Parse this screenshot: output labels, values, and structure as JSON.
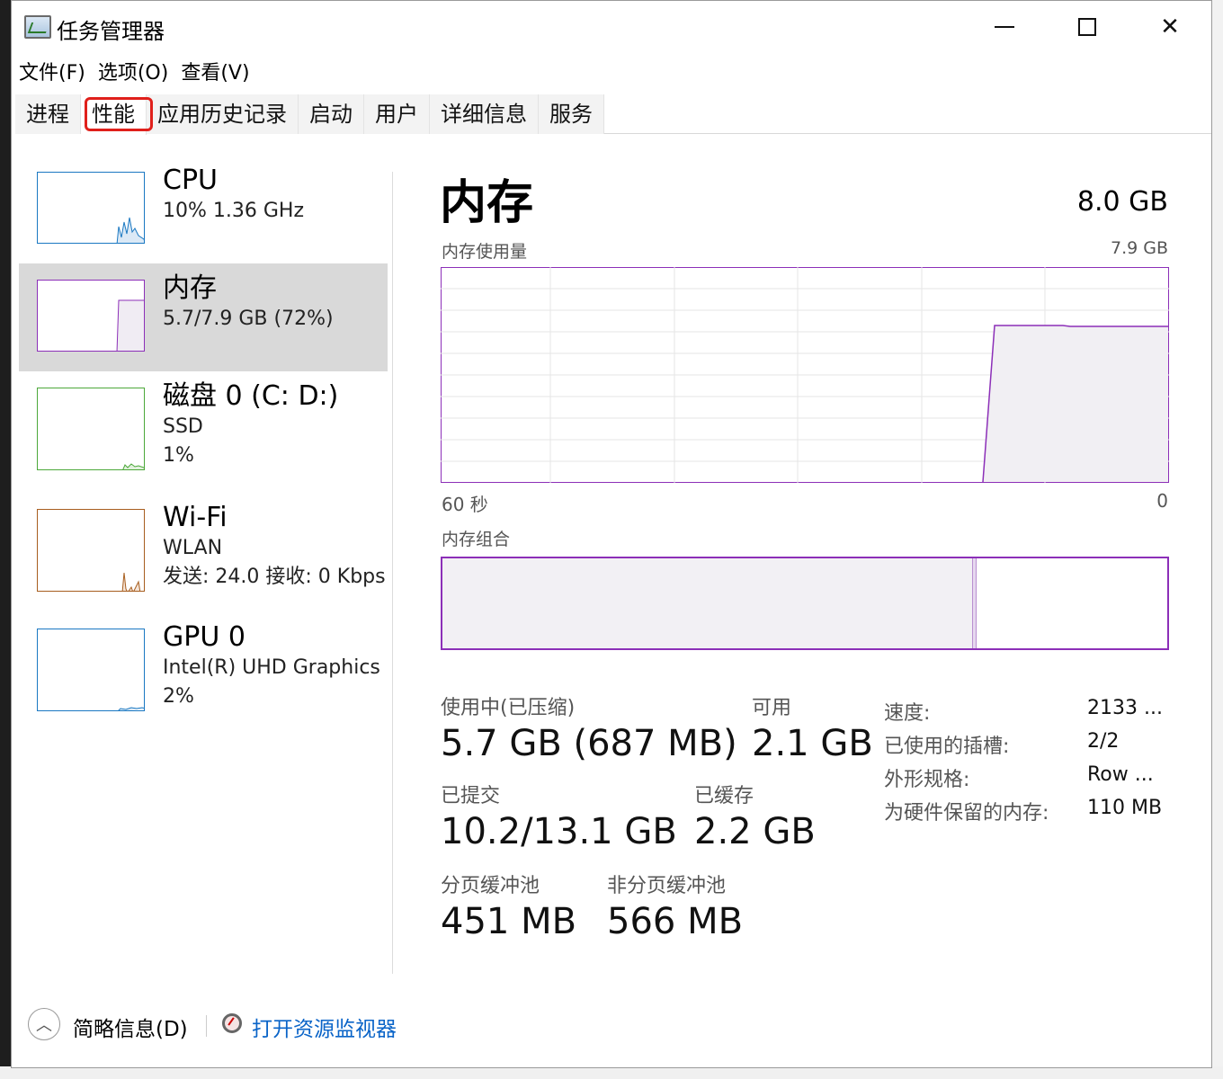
{
  "window": {
    "title": "任务管理器"
  },
  "menu": [
    "文件(F)",
    "选项(O)",
    "查看(V)"
  ],
  "tabs": [
    "进程",
    "性能",
    "应用历史记录",
    "启动",
    "用户",
    "详细信息",
    "服务"
  ],
  "active_tab": "性能",
  "sidebar": [
    {
      "title": "CPU",
      "lines": [
        "10%  1.36 GHz"
      ],
      "color": "#1a78c2"
    },
    {
      "title": "内存",
      "lines": [
        "5.7/7.9 GB (72%)"
      ],
      "color": "#8c2fb8"
    },
    {
      "title": "磁盘 0 (C: D:)",
      "lines": [
        "SSD",
        "1%"
      ],
      "color": "#4ca83a"
    },
    {
      "title": "Wi-Fi",
      "lines": [
        "WLAN",
        "发送: 24.0  接收: 0 Kbps"
      ],
      "color": "#a75d1e"
    },
    {
      "title": "GPU 0",
      "lines": [
        "Intel(R) UHD Graphics",
        "2%"
      ],
      "color": "#1a78c2"
    }
  ],
  "main": {
    "title": "内存",
    "total": "8.0 GB",
    "usage_label": "内存使用量",
    "usage_max": "7.9 GB",
    "axis_left": "60 秒",
    "axis_right": "0",
    "composition_label": "内存组合",
    "stats": {
      "in_use_label": "使用中(已压缩)",
      "in_use_value": "5.7 GB (687 MB)",
      "available_label": "可用",
      "available_value": "2.1 GB",
      "committed_label": "已提交",
      "committed_value": "10.2/13.1 GB",
      "cached_label": "已缓存",
      "cached_value": "2.2 GB",
      "paged_label": "分页缓冲池",
      "paged_value": "451 MB",
      "nonpaged_label": "非分页缓冲池",
      "nonpaged_value": "566 MB"
    },
    "details": [
      {
        "key": "速度:",
        "value": "2133 ..."
      },
      {
        "key": "已使用的插槽:",
        "value": "2/2"
      },
      {
        "key": "外形规格:",
        "value": "Row ..."
      },
      {
        "key": "为硬件保留的内存:",
        "value": "110 MB"
      }
    ]
  },
  "footer": {
    "brief": "简略信息(D)",
    "link": "打开资源监视器"
  },
  "colors": {
    "memory": "#8c2fb8",
    "cpu": "#1a78c2",
    "disk": "#4ca83a",
    "wifi": "#a75d1e",
    "link": "#0a64c8"
  }
}
